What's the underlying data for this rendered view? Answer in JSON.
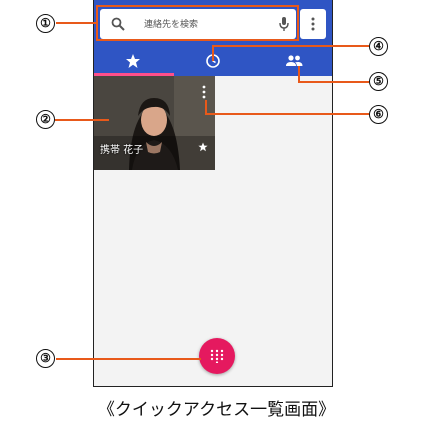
{
  "search": {
    "placeholder": "連絡先を検索"
  },
  "tabs": [
    {
      "id": "favorites",
      "icon": "star-icon"
    },
    {
      "id": "recent",
      "icon": "clock-icon"
    },
    {
      "id": "contacts",
      "icon": "people-icon"
    }
  ],
  "favorite_card": {
    "name": "携帯 花子"
  },
  "callouts": [
    "①",
    "②",
    "③",
    "④",
    "⑤",
    "⑥"
  ],
  "caption": "《クイックアクセス一覧画面》",
  "colors": {
    "appbar": "#2f55c4",
    "accent": "#e5195f",
    "callout": "#e8591a",
    "tab_indicator": "#ff4f8b"
  }
}
